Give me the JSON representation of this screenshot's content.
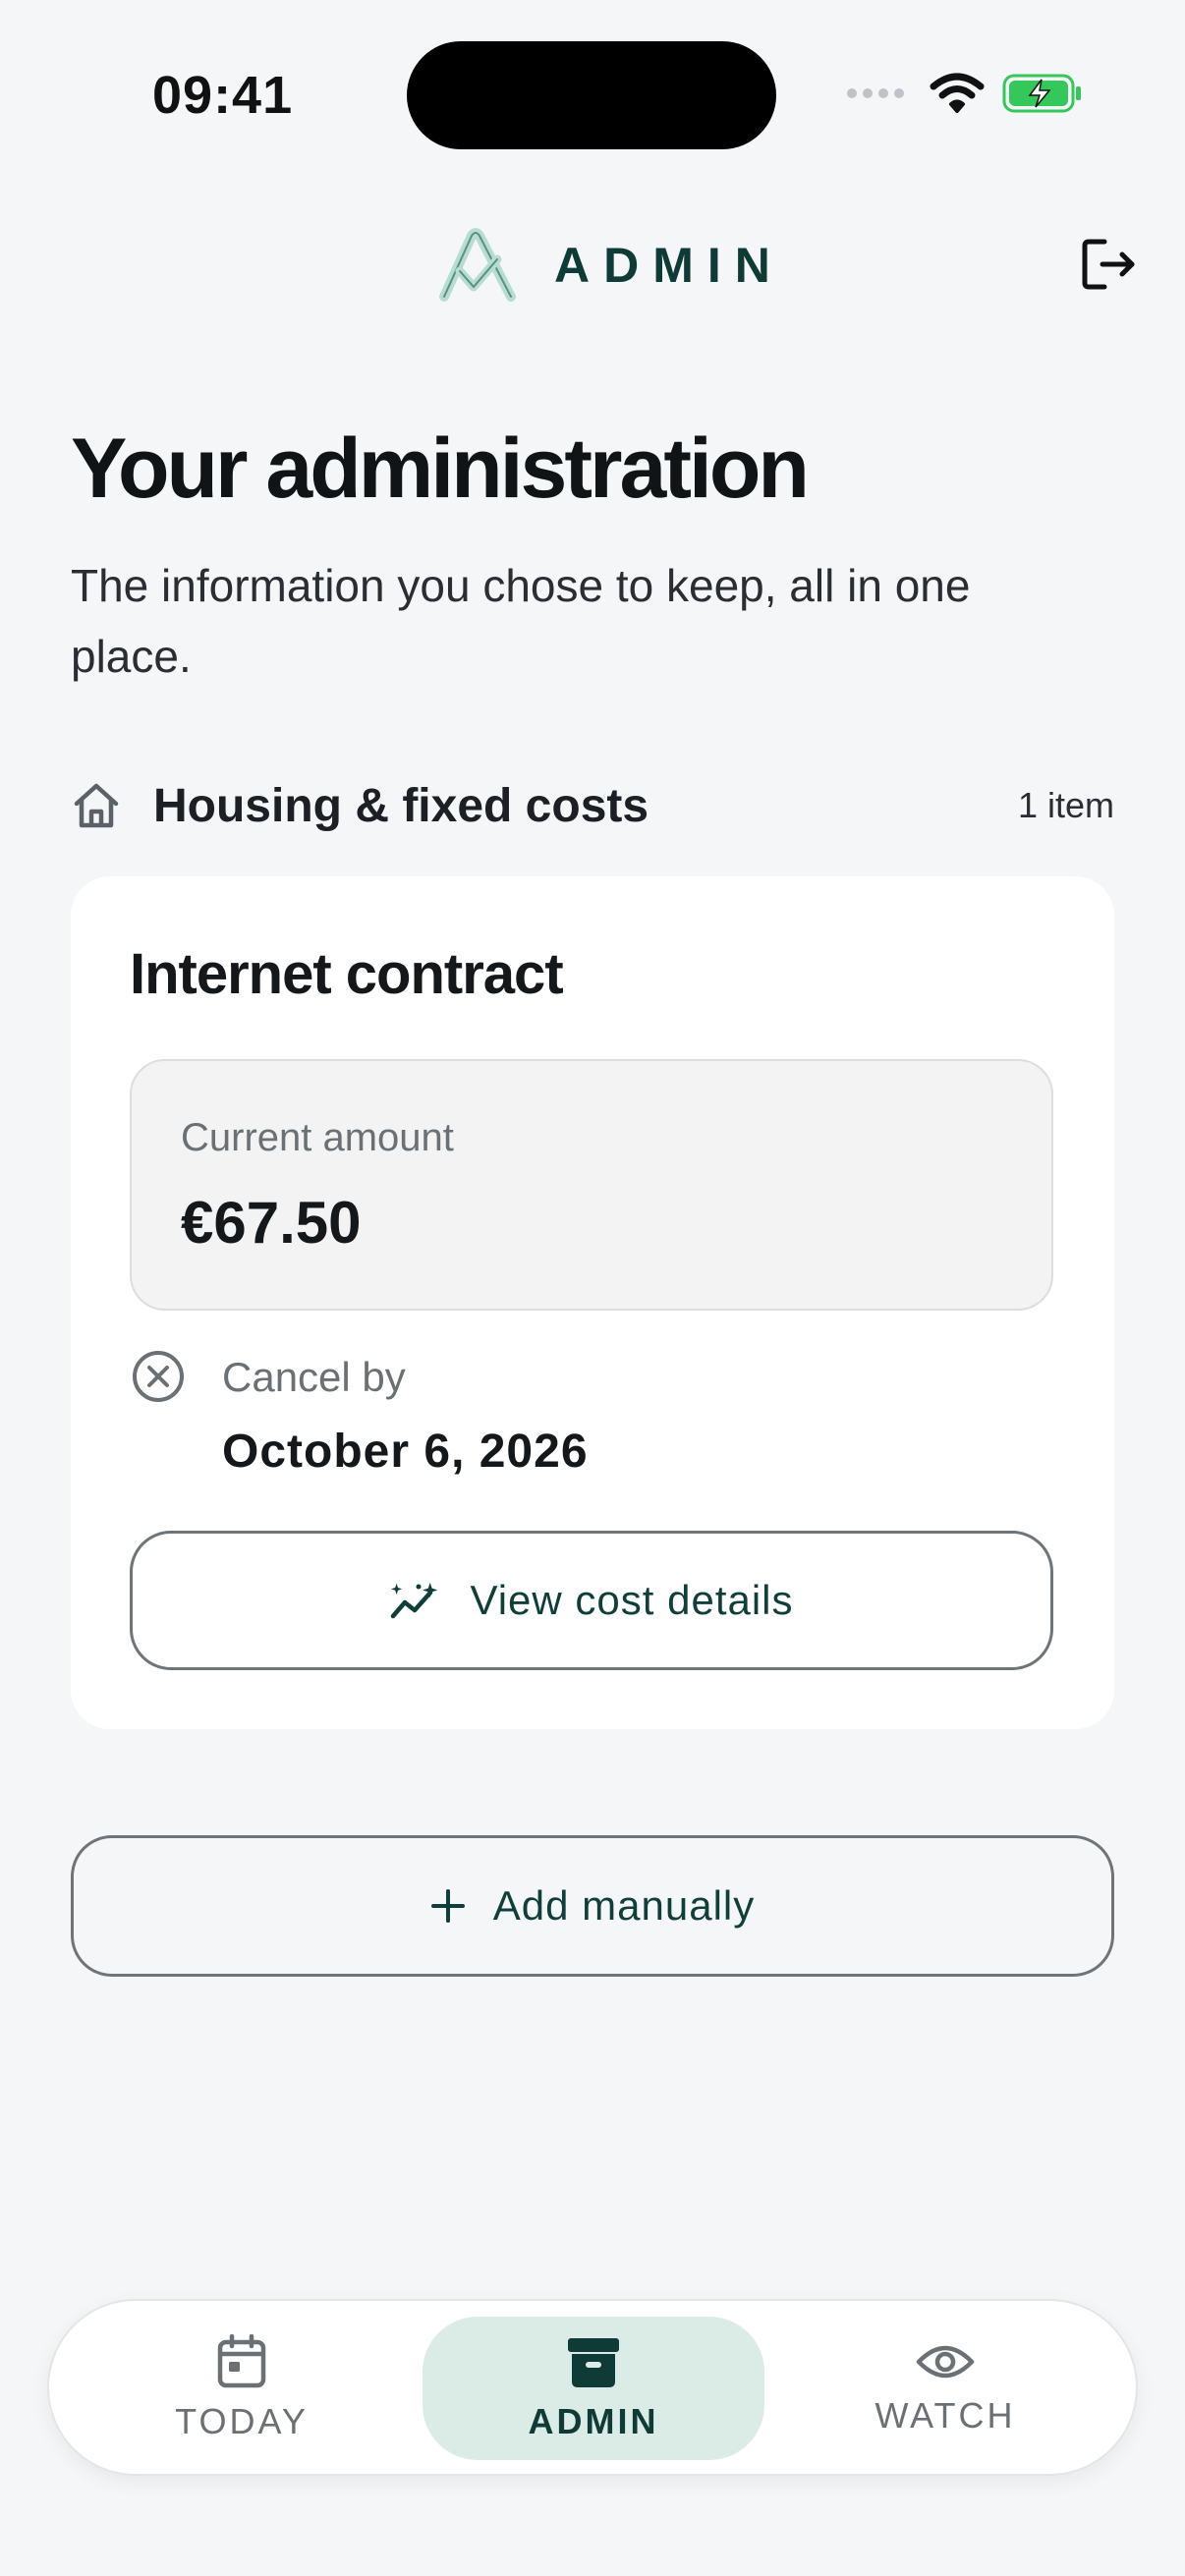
{
  "status_bar": {
    "time": "09:41"
  },
  "header": {
    "brand_name": "ADMIN",
    "logo_icon": "brand-logo-icon",
    "logout_icon": "logout-icon"
  },
  "page": {
    "title": "Your administration",
    "subtitle": "The information you chose to keep, all in one place."
  },
  "section": {
    "icon": "home-icon",
    "title": "Housing & fixed costs",
    "count": "1 item"
  },
  "card": {
    "title": "Internet contract",
    "amount_label": "Current amount",
    "amount_value": "€67.50",
    "cancel_label": "Cancel by",
    "cancel_date": "October 6, 2026",
    "view_details_label": "View cost details"
  },
  "actions": {
    "add_manually_label": "Add manually"
  },
  "bottom_nav": {
    "items": [
      {
        "label": "TODAY",
        "icon": "calendar-icon",
        "active": false
      },
      {
        "label": "ADMIN",
        "icon": "archive-icon",
        "active": true
      },
      {
        "label": "WATCH",
        "icon": "eye-icon",
        "active": false
      }
    ]
  },
  "colors": {
    "brand": "#0f3b37",
    "active_nav_bg": "#dbece6",
    "battery": "#34c759",
    "background": "#f5f6f8"
  }
}
